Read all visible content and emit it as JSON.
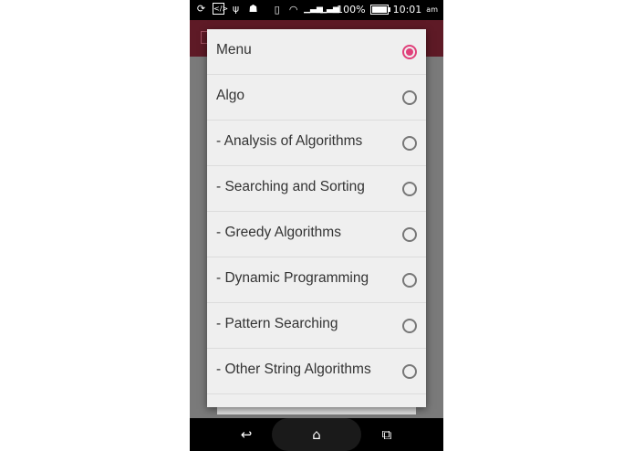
{
  "status_bar": {
    "battery": "100%",
    "time": "10:01",
    "time_suffix": "am"
  },
  "dialog": {
    "options": [
      {
        "label": "Menu",
        "checked": true
      },
      {
        "label": "Algo",
        "checked": false
      },
      {
        "label": "- Analysis of Algorithms",
        "checked": false
      },
      {
        "label": "- Searching and Sorting",
        "checked": false
      },
      {
        "label": "- Greedy Algorithms",
        "checked": false
      },
      {
        "label": "- Dynamic Programming",
        "checked": false
      },
      {
        "label": "- Pattern Searching",
        "checked": false
      },
      {
        "label": "- Other String Algorithms",
        "checked": false
      }
    ]
  },
  "colors": {
    "app_bar": "#5e1a26",
    "accent": "#e0407a",
    "dialog_bg": "#efefef"
  },
  "icons": [
    "sync-icon",
    "code-icon",
    "usb-icon",
    "android-icon",
    "vibrate-icon",
    "wifi-icon",
    "signal-icon",
    "battery-icon",
    "back-icon",
    "home-icon",
    "recents-icon"
  ]
}
